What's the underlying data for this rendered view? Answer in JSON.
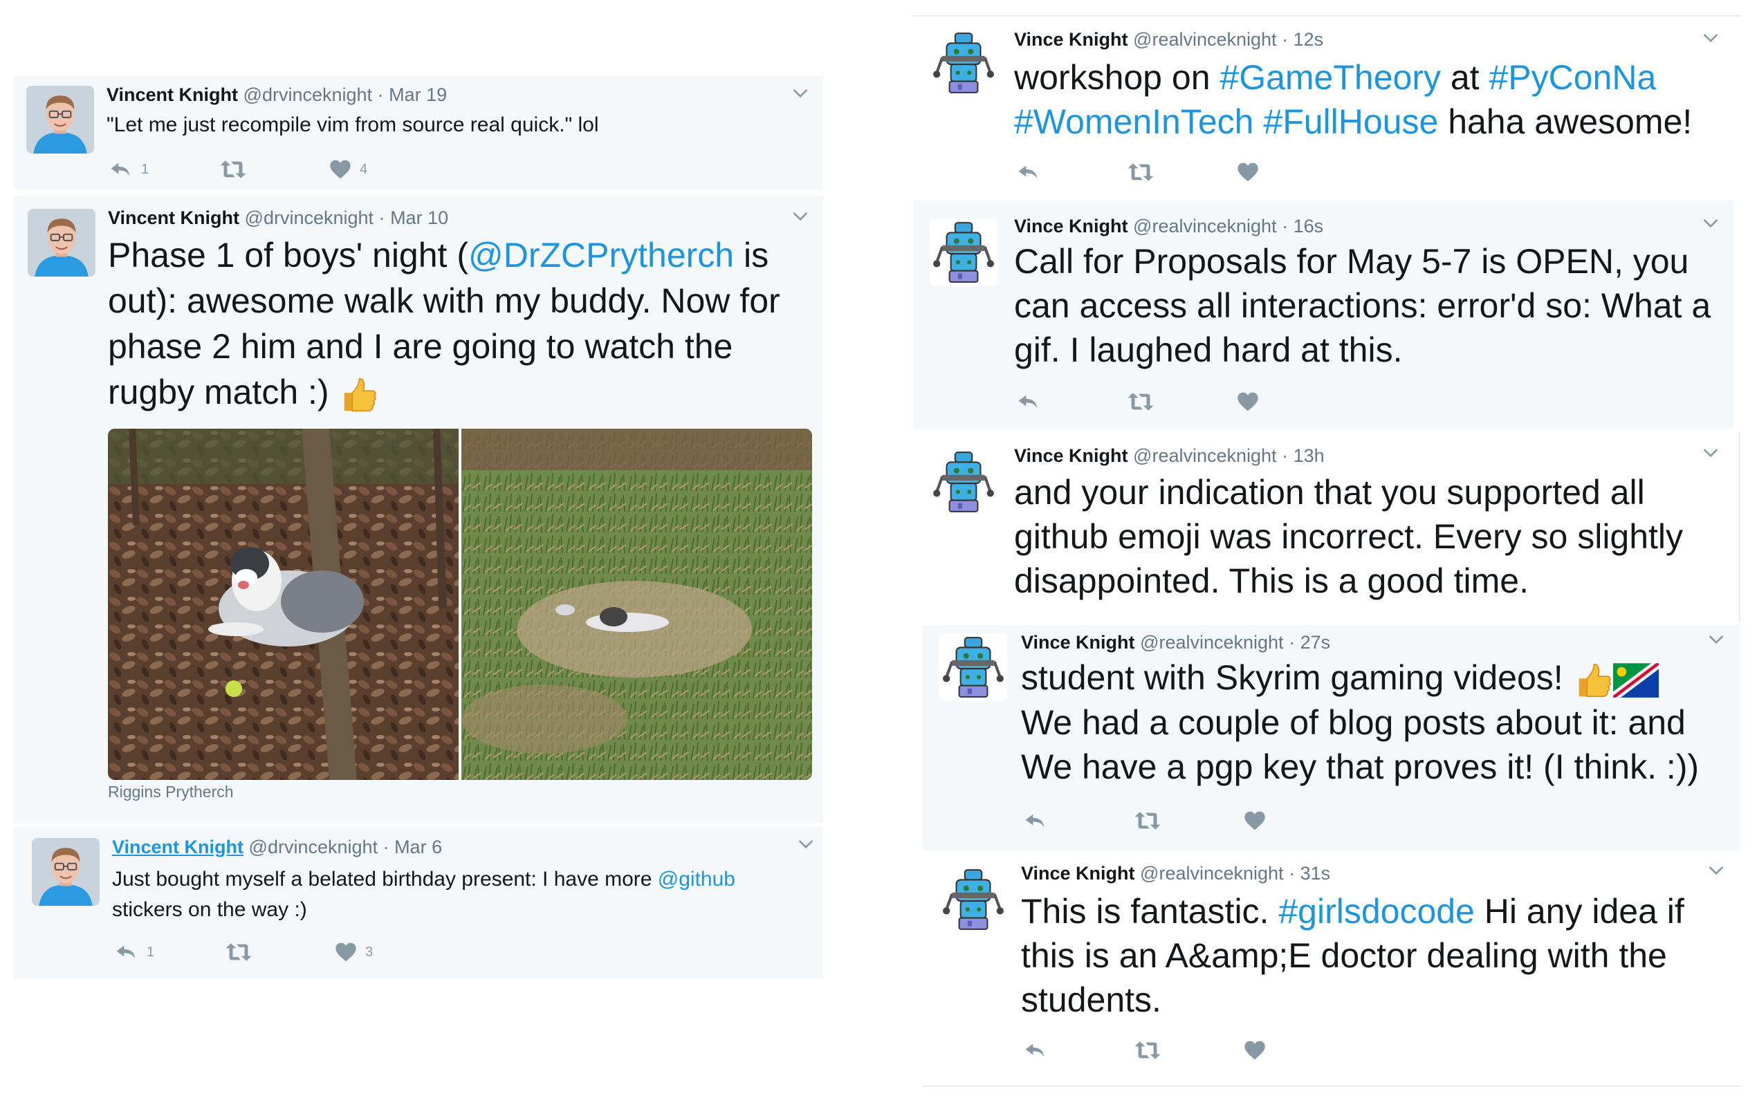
{
  "left_tweets": [
    {
      "name": "Vincent Knight",
      "handle": "@drvinceknight",
      "time": "Mar 19",
      "text": "\"Let me just recompile vim from source real quick.\" lol",
      "replies": "1",
      "likes": "4"
    },
    {
      "name": "Vincent Knight",
      "handle": "@drvinceknight",
      "time": "Mar 10",
      "text_parts": [
        "Phase 1 of boys' night (",
        "@DrZCPrytherch",
        " is out): awesome walk with my buddy. Now for phase 2 him and I are going to watch the rugby match :)"
      ],
      "photo_caption": "Riggins Prytherch"
    },
    {
      "name": "Vincent Knight",
      "handle": "@drvinceknight",
      "time": "Mar 6",
      "text_parts": [
        "Just bought myself a belated birthday present: I have more ",
        "@github",
        " stickers on the way :)"
      ],
      "replies": "1",
      "likes": "3"
    }
  ],
  "right_tweets": [
    {
      "name": "Vince Knight",
      "handle": "@realvinceknight",
      "time": "12s",
      "text_parts": [
        "workshop on ",
        "#GameTheory",
        " at ",
        "#PyConNa",
        " ",
        "#WomenInTech",
        " ",
        "#FullHouse",
        " haha awesome!"
      ]
    },
    {
      "name": "Vince Knight",
      "handle": "@realvinceknight",
      "time": "16s",
      "text": "Call for Proposals for May 5-7 is OPEN, you can access all interactions: error'd so: What a gif. I laughed hard at this."
    },
    {
      "name": "Vince Knight",
      "handle": "@realvinceknight",
      "time": "13h",
      "text": "and your indication that you supported all github emoji was incorrect. Every so slightly disappointed. This is a good time."
    },
    {
      "name": "Vince Knight",
      "handle": "@realvinceknight",
      "time": "27s",
      "text_a": "student with Skyrim gaming videos!",
      "text_b": "We had a couple of blog posts about it: and We have a pgp key that proves it! (I think. :))"
    },
    {
      "name": "Vince Knight",
      "handle": "@realvinceknight",
      "time": "31s",
      "text_parts": [
        "This is fantastic. ",
        "#girlsdocode",
        " Hi any idea if this is an A&amp;E doctor dealing with the students."
      ]
    }
  ],
  "icons": {
    "reply": "reply-icon",
    "retweet": "retweet-icon",
    "like": "heart-icon",
    "menu": "chevron-down-icon"
  },
  "colors": {
    "link": "#1b95e0",
    "muted": "#8899a6",
    "card_bg": "#f5f8fa"
  }
}
